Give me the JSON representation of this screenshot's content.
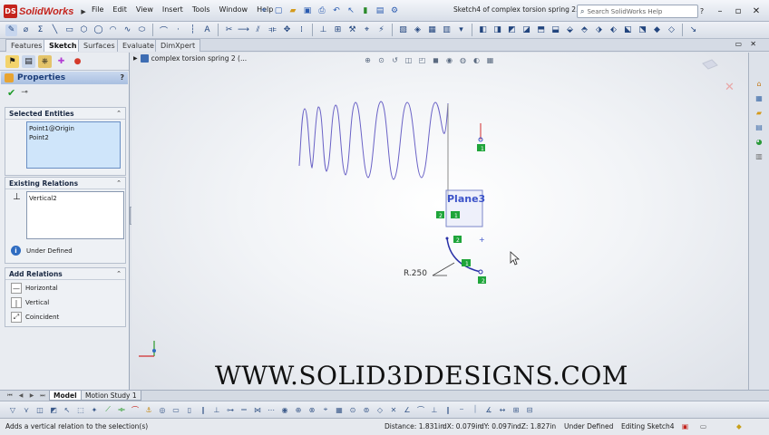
{
  "app": {
    "name": "SolidWorks",
    "ds_mark": "DS"
  },
  "menu": [
    "File",
    "Edit",
    "View",
    "Insert",
    "Tools",
    "Window",
    "Help"
  ],
  "window_title": "Sketch4 of complex torsion spring 2.SL...",
  "search": {
    "placeholder": "Search SolidWorks Help"
  },
  "cm_tabs": [
    "Features",
    "Sketch",
    "Surfaces",
    "Evaluate",
    "DimXpert"
  ],
  "active_cm_tab": "Sketch",
  "property_manager": {
    "title": "Properties",
    "help": "?",
    "selected_entities": {
      "header": "Selected Entities",
      "items": [
        "Point1@Origin",
        "Point2"
      ]
    },
    "existing_relations": {
      "header": "Existing Relations",
      "items": [
        "Vertical2"
      ],
      "status": "Under Defined"
    },
    "add_relations": {
      "header": "Add Relations",
      "items": [
        "Horizontal",
        "Vertical",
        "Coincident"
      ]
    }
  },
  "graphics": {
    "tree_label": "complex torsion spring 2  (...",
    "plane_label": "Plane3",
    "radius_label": "R.250",
    "watermark": "WWW.SOLID3DDESIGNS.COM",
    "badges": [
      "1",
      "2",
      "1",
      "2",
      "1",
      "2"
    ]
  },
  "bottom_tabs": [
    "Model",
    "Motion Study 1"
  ],
  "status": {
    "message": "Adds a vertical relation to the selection(s)",
    "distance": "Distance: 1.831in",
    "dx": "dX: 0.079in",
    "dy": "dY: 0.097in",
    "dz": "dZ: 1.827in",
    "definition": "Under Defined",
    "mode": "Editing Sketch4"
  },
  "colors": {
    "accent": "#c4231c",
    "sketch_blue": "#3c53c9",
    "relation_green": "#1fa53a"
  }
}
